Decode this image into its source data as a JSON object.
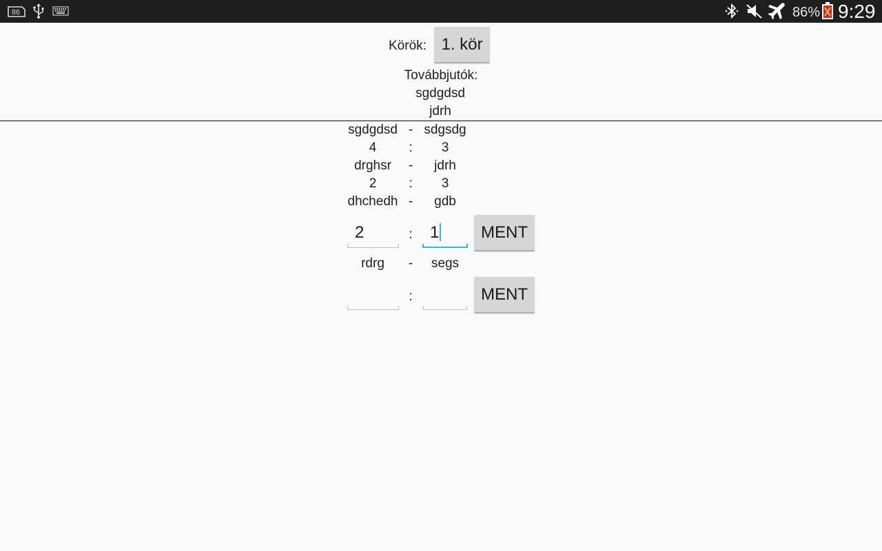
{
  "status_bar": {
    "notification_icons": [
      "sim-86-icon",
      "usb-icon",
      "keyboard-icon"
    ],
    "system_icons": [
      "bluetooth-icon",
      "mute-icon",
      "airplane-mode-icon",
      "battery-icon"
    ],
    "battery_percent": "86%",
    "time": "9:29"
  },
  "header": {
    "rounds_label": "Körök:",
    "round_button": "1. kör",
    "advancers_label": "Továbbjutók:",
    "advancers": [
      "sgdgdsd",
      "jdrh"
    ]
  },
  "matches": [
    {
      "home": "sgdgdsd",
      "sep": "-",
      "away": "sdgsdg",
      "score_home": "4",
      "colon": ":",
      "score_away": "3"
    },
    {
      "home": "drghsr",
      "sep": "-",
      "away": "jdrh",
      "score_home": "2",
      "colon": ":",
      "score_away": "3"
    },
    {
      "home": "dhchedh",
      "sep": "-",
      "away": "gdb",
      "input_home": "2",
      "colon": ":",
      "input_away": "1",
      "save": "MENT"
    },
    {
      "home": "rdrg",
      "sep": "-",
      "away": "segs",
      "input_home": "",
      "colon": ":",
      "input_away": "",
      "save": "MENT"
    }
  ],
  "colors": {
    "background": "#f9f9f9",
    "status_bar": "#1f1f1f",
    "button": "#d6d6d6",
    "focus_accent": "#33b5e5"
  }
}
